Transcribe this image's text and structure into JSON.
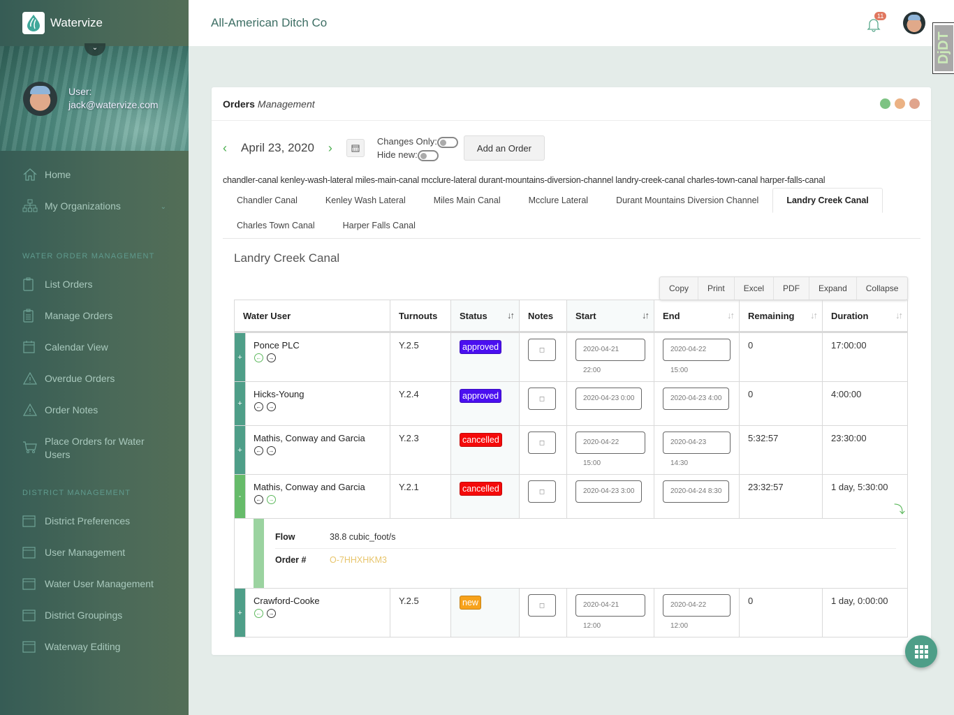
{
  "app": {
    "name": "Watervize",
    "organization": "All-American Ditch Co"
  },
  "user": {
    "label": "User:",
    "email": "jack@watervize.com"
  },
  "notifications": {
    "count": "11"
  },
  "debug_toolbar": {
    "label": "DjDT"
  },
  "sidebar": {
    "top_items": [
      {
        "label": "Home",
        "icon": "home-icon"
      },
      {
        "label": "My Organizations",
        "icon": "org-chart-icon",
        "has_caret": true
      }
    ],
    "sections": [
      {
        "title": "WATER ORDER MANAGEMENT",
        "items": [
          {
            "label": "List Orders",
            "icon": "clipboard-icon"
          },
          {
            "label": "Manage Orders",
            "icon": "clipboard-list-icon"
          },
          {
            "label": "Calendar View",
            "icon": "calendar-icon"
          },
          {
            "label": "Overdue Orders",
            "icon": "warning-icon"
          },
          {
            "label": "Order Notes",
            "icon": "warning-icon"
          },
          {
            "label": "Place Orders for Water Users",
            "icon": "cart-icon"
          }
        ]
      },
      {
        "title": "DISTRICT MANAGEMENT",
        "items": [
          {
            "label": "District Preferences",
            "icon": "window-icon"
          },
          {
            "label": "User Management",
            "icon": "window-icon"
          },
          {
            "label": "Water User Management",
            "icon": "window-icon"
          },
          {
            "label": "District Groupings",
            "icon": "window-icon"
          },
          {
            "label": "Waterway Editing",
            "icon": "window-icon"
          }
        ]
      }
    ]
  },
  "card": {
    "title_bold": "Orders",
    "title_italic": "Management",
    "window_dots": [
      "#7dc383",
      "#ebb284",
      "#e0a48c"
    ],
    "date": "April 23, 2020",
    "changes_only_label": "Changes Only:",
    "hide_new_label": "Hide new:",
    "add_order_label": "Add an Order",
    "slug_line": "chandler-canal kenley-wash-lateral miles-main-canal mcclure-lateral durant-mountains-diversion-channel landry-creek-canal charles-town-canal harper-falls-canal",
    "tabs": [
      {
        "label": "Chandler Canal",
        "active": false
      },
      {
        "label": "Kenley Wash Lateral",
        "active": false
      },
      {
        "label": "Miles Main Canal",
        "active": false
      },
      {
        "label": "Mcclure Lateral",
        "active": false
      },
      {
        "label": "Durant Mountains Diversion Channel",
        "active": false
      },
      {
        "label": "Landry Creek Canal",
        "active": true
      },
      {
        "label": "Charles Town Canal",
        "active": false
      },
      {
        "label": "Harper Falls Canal",
        "active": false
      }
    ],
    "section_title": "Landry Creek Canal",
    "export_buttons": [
      "Copy",
      "Print",
      "Excel",
      "PDF",
      "Expand",
      "Collapse"
    ],
    "columns": [
      "Water User",
      "Turnouts",
      "Status",
      "Notes",
      "Start",
      "End",
      "Remaining",
      "Duration"
    ],
    "status_colors": {
      "approved": "#4a0ff0",
      "cancelled": "#f40a0a",
      "new": "#f7a21b"
    },
    "rows": [
      {
        "expander": "+",
        "water_user": "Ponce PLC",
        "prev_active": true,
        "next_active": false,
        "turnout": "Y.2.5",
        "status": "approved",
        "start": "2020-04-21 22:00",
        "end": "2020-04-22 15:00",
        "remaining": "0",
        "duration": "17:00:00"
      },
      {
        "expander": "+",
        "water_user": "Hicks-Young",
        "prev_active": false,
        "next_active": false,
        "turnout": "Y.2.4",
        "status": "approved",
        "start": "2020-04-23 0:00",
        "end": "2020-04-23 4:00",
        "remaining": "0",
        "duration": "4:00:00"
      },
      {
        "expander": "+",
        "water_user": "Mathis, Conway and Garcia",
        "prev_active": false,
        "next_active": false,
        "turnout": "Y.2.3",
        "status": "cancelled",
        "start": "2020-04-22 15:00",
        "end": "2020-04-23 14:30",
        "remaining": "5:32:57",
        "duration": "23:30:00"
      },
      {
        "expander": "-",
        "water_user": "Mathis, Conway and Garcia",
        "prev_active": false,
        "next_active": true,
        "turnout": "Y.2.1",
        "status": "cancelled",
        "start": "2020-04-23 3:00",
        "end": "2020-04-24 8:30",
        "remaining": "23:32:57",
        "duration": "1 day, 5:30:00",
        "detail": {
          "flow_label": "Flow",
          "flow": "38.8 cubic_foot/s",
          "order_label": "Order #",
          "order_no": "O-7HHXHKM3"
        }
      },
      {
        "expander": "+",
        "water_user": "Crawford-Cooke",
        "prev_active": true,
        "next_active": false,
        "turnout": "Y.2.5",
        "status": "new",
        "start": "2020-04-21 12:00",
        "end": "2020-04-22 12:00",
        "remaining": "0",
        "duration": "1 day, 0:00:00"
      }
    ]
  }
}
